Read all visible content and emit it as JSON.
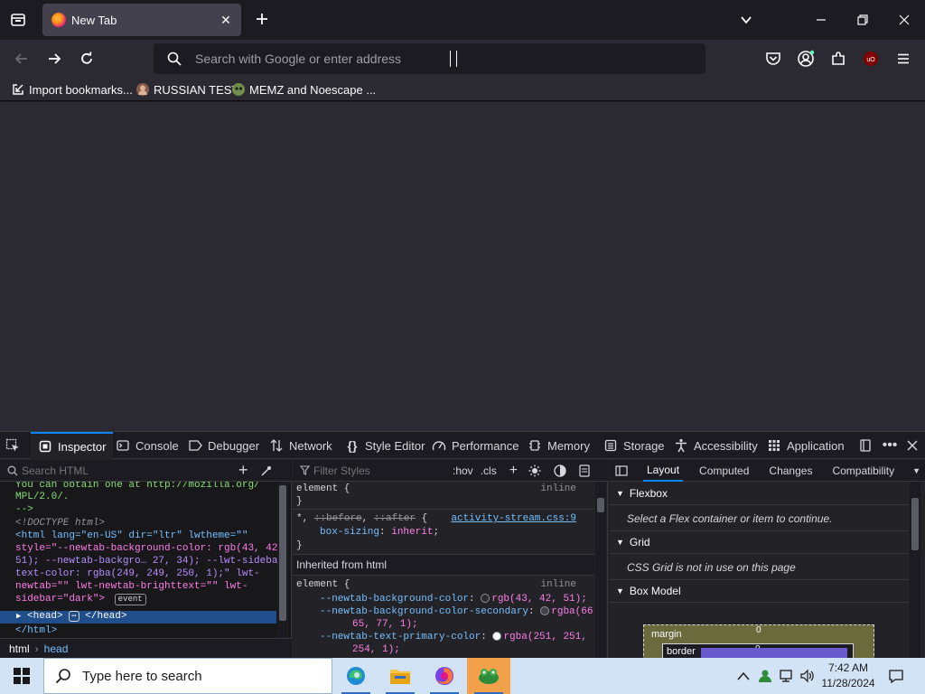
{
  "browser": {
    "tab": {
      "title": "New Tab"
    },
    "urlbar": {
      "placeholder": "Search with Google or enter address"
    },
    "bookmarks": [
      {
        "label": "Import bookmarks...",
        "icon": "import-icon"
      },
      {
        "label": "RUSSIAN TEST",
        "icon": "site-favicon"
      },
      {
        "label": "MEMZ and Noescape ...",
        "icon": "site-favicon"
      }
    ]
  },
  "devtools": {
    "tabs": [
      {
        "label": "Inspector",
        "icon": "inspector-icon"
      },
      {
        "label": "Console",
        "icon": "console-icon"
      },
      {
        "label": "Debugger",
        "icon": "debugger-icon"
      },
      {
        "label": "Network",
        "icon": "network-icon"
      },
      {
        "label": "Style Editor",
        "icon": "braces-icon"
      },
      {
        "label": "Performance",
        "icon": "gauge-icon"
      },
      {
        "label": "Memory",
        "icon": "chip-icon"
      },
      {
        "label": "Storage",
        "icon": "storage-icon"
      },
      {
        "label": "Accessibility",
        "icon": "accessibility-icon"
      },
      {
        "label": "Application",
        "icon": "grid-icon"
      }
    ],
    "html_pane": {
      "search_placeholder": "Search HTML",
      "lines": [
        "You can obtain one at http://mozilla.org/",
        "MPL/2.0/.",
        "-->",
        "<!DOCTYPE html>",
        "<html lang=\"en-US\" dir=\"ltr\" lwtheme=\"\"",
        "style=\"--newtab-background-color: rgb(43, 42,",
        "51); --newtab-backgro… 27, 34); --lwt-sidebar-",
        "text-color: rgba(249, 249, 250, 1);\" lwt-",
        "newtab=\"\" lwt-newtab-brighttext=\"\" lwt-",
        "sidebar=\"dark\">",
        "<head>",
        "</head>",
        "</html>"
      ],
      "event_badge": "event",
      "ellipsis_badge": "⋯",
      "breadcrumb": [
        "html",
        "head"
      ]
    },
    "rules_pane": {
      "filter_placeholder": "Filter Styles",
      "hov": ":hov",
      "cls": ".cls",
      "rule1_selector": "element {",
      "rule1_source": "inline",
      "rule1_close": "}",
      "rule2_selector_a": "*, ",
      "rule2_before": "::before",
      "rule2_sep": ", ",
      "rule2_after": "::after",
      "rule2_brace": " {",
      "rule2_source": "activity-stream.css:9",
      "rule2_prop": "box-sizing",
      "rule2_value": "inherit",
      "rule2_close": "}",
      "inherited_header": "Inherited from html",
      "rule3_selector": "element {",
      "rule3_source": "inline",
      "rule3_props": [
        {
          "name": "--newtab-background-color",
          "value": "rgb(43, 42, 51);",
          "swatch": "#2b2a33"
        },
        {
          "name": "--newtab-background-color-secondary",
          "value": "rgba(66,",
          "value_cont": "65, 77, 1);",
          "swatch": "#42414d"
        },
        {
          "name": "--newtab-text-primary-color",
          "value": "rgba(251, 251,",
          "value_cont": "254, 1);",
          "swatch": "#fbfbfe"
        }
      ]
    },
    "layout_pane": {
      "tabs": [
        "Layout",
        "Computed",
        "Changes",
        "Compatibility"
      ],
      "flexbox_title": "Flexbox",
      "flexbox_body": "Select a Flex container or item to continue.",
      "grid_title": "Grid",
      "grid_body": "CSS Grid is not in use on this page",
      "boxmodel_title": "Box Model",
      "margin_label": "margin",
      "border_label": "border",
      "margin_value": "0",
      "border_value": "0"
    }
  },
  "taskbar": {
    "search_placeholder": "Type here to search",
    "time": "7:42 AM",
    "date": "11/28/2024"
  },
  "colors": {
    "tab_bg": "#42414d",
    "toolbar_bg": "#2b2a33",
    "accent": "#0a84ff",
    "taskbar_bg": "#d3e3f6"
  }
}
